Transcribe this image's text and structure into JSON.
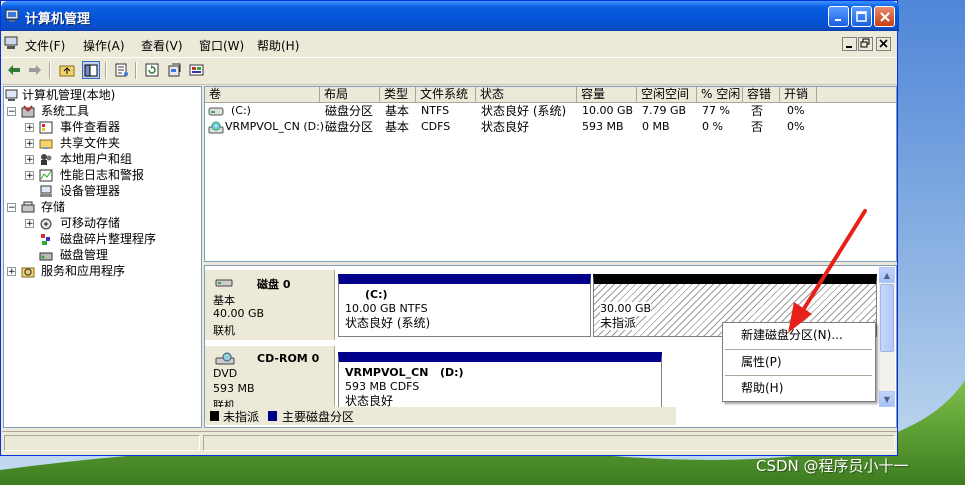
{
  "window": {
    "title": "计算机管理"
  },
  "menu": [
    "文件(F)",
    "操作(A)",
    "查看(V)",
    "窗口(W)",
    "帮助(H)"
  ],
  "tree": {
    "root": "计算机管理(本地)",
    "system_tools": "系统工具",
    "event_viewer": "事件查看器",
    "shared_folders": "共享文件夹",
    "local_users": "本地用户和组",
    "perf_logs": "性能日志和警报",
    "device_manager": "设备管理器",
    "storage": "存储",
    "removable": "可移动存储",
    "defrag": "磁盘碎片整理程序",
    "disk_mgmt": "磁盘管理",
    "services": "服务和应用程序"
  },
  "volumes": {
    "headers": [
      "卷",
      "布局",
      "类型",
      "文件系统",
      "状态",
      "容量",
      "空闲空间",
      "% 空闲",
      "容错",
      "开销"
    ],
    "rows": [
      [
        "(C:)",
        "磁盘分区",
        "基本",
        "NTFS",
        "状态良好 (系统)",
        "10.00 GB",
        "7.79 GB",
        "77 %",
        "否",
        "0%"
      ],
      [
        "VRMPVOL_CN (D:)",
        "磁盘分区",
        "基本",
        "CDFS",
        "状态良好",
        "593 MB",
        "0 MB",
        "0 %",
        "否",
        "0%"
      ]
    ]
  },
  "disks": [
    {
      "name": "磁盘 0",
      "type": "基本",
      "size": "40.00 GB",
      "status": "联机",
      "partitions": [
        {
          "title": "(C:)",
          "line1": "10.00 GB NTFS",
          "line2": "状态良好 (系统)"
        },
        {
          "title": "",
          "line1": "30.00 GB",
          "line2": "未指派"
        }
      ]
    },
    {
      "name": "CD-ROM 0",
      "type": "DVD",
      "size": "593 MB",
      "status": "联机",
      "partitions": [
        {
          "title": "VRMPVOL_CN   (D:)",
          "line1": "593 MB CDFS",
          "line2": "状态良好"
        }
      ]
    }
  ],
  "legend": {
    "unallocated": "未指派",
    "primary": "主要磁盘分区"
  },
  "context_menu": {
    "new_partition": "新建磁盘分区(N)...",
    "properties": "属性(P)",
    "help": "帮助(H)"
  },
  "watermark": "CSDN @程序员小十一",
  "colors": {
    "primary_partition": "#00008b",
    "unallocated": "#000000",
    "title_bar": "#0a5fe0",
    "arrow": "#e8201a"
  }
}
